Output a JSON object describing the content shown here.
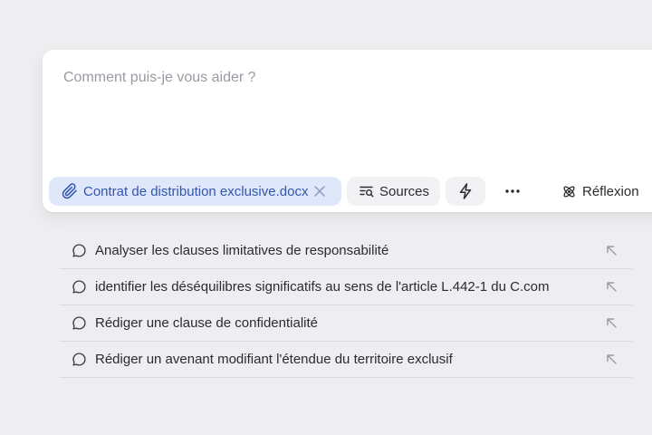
{
  "composer": {
    "placeholder": "Comment puis-je vous aider ?",
    "attachment": {
      "file_name": "Contrat de distribution exclusive.docx",
      "icon": "paperclip-icon"
    },
    "sources_label": "Sources",
    "reflexion_label": "Réflexion"
  },
  "suggestions": [
    {
      "label": "Analyser les clauses limitatives de responsabilité"
    },
    {
      "label": "identifier les déséquilibres significatifs au sens de l'article L.442-1 du C.com"
    },
    {
      "label": "Rédiger une clause de confidentialité"
    },
    {
      "label": "Rédiger un avenant modifiant l'étendue du territoire exclusif"
    }
  ],
  "colors": {
    "background": "#eeeef0",
    "attachment_chip_bg": "#dfe7fb",
    "attachment_text": "#3356ad",
    "placeholder": "#9a9aa3"
  }
}
